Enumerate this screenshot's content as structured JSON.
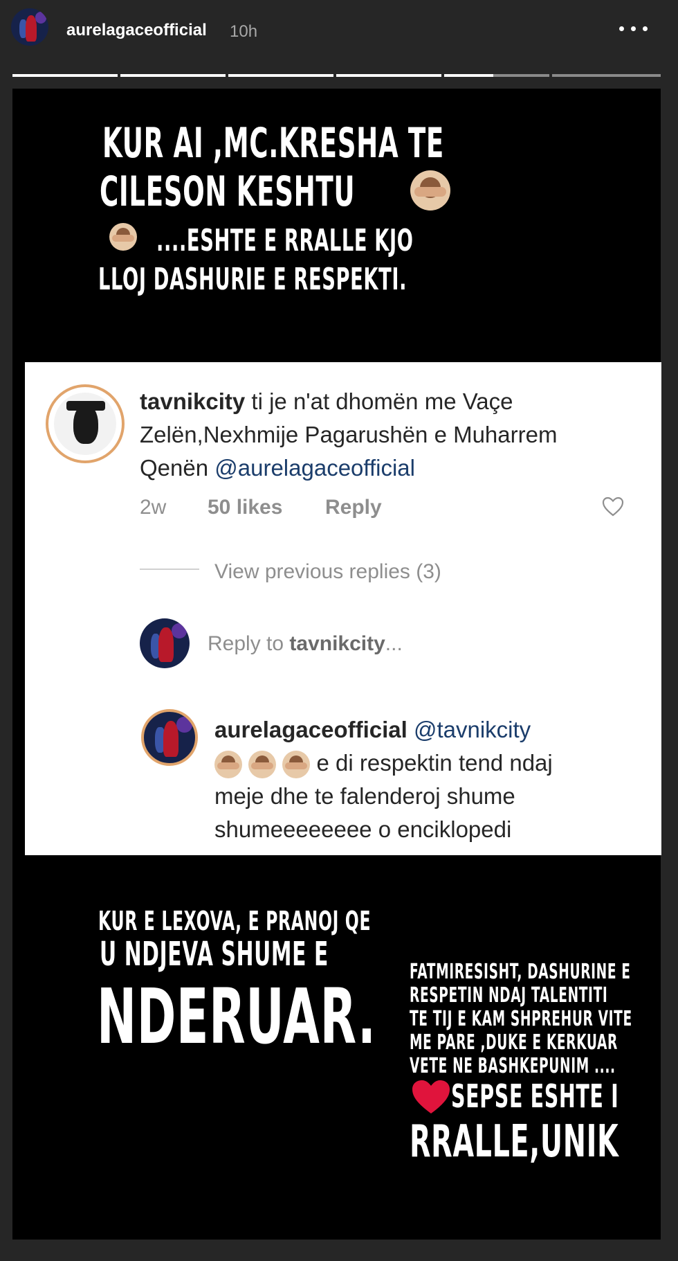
{
  "header": {
    "username": "aurelagaceofficial",
    "time": "10h",
    "more_icon": "more-horizontal-icon"
  },
  "progress": {
    "segments": 6,
    "current_index": 4,
    "current_fraction": 0.47
  },
  "story": {
    "top_text_lines": [
      "KUR AI ,MC.KRESHA TE",
      "CILESON KESHTU",
      "....ESHTE E RRALLE KJO",
      "LLOJ DASHURIE E RESPEKTI."
    ],
    "comment": {
      "username": "tavnikcity",
      "text_line1": " ti je n'at dhomën me Vaçe",
      "text_line2": "Zelën,Nexhmije Pagarushën e Muharrem",
      "text_line3": "Qenën ",
      "mention": "@aurelagaceofficial",
      "age": "2w",
      "likes": "50 likes",
      "reply": "Reply",
      "view_replies": "View previous replies (3)",
      "reply_to_prefix": "Reply to ",
      "reply_to_user": "tavnikcity",
      "reply_to_suffix": "...",
      "reply_username": "aurelagaceofficial",
      "reply_mention": " @tavnikcity",
      "reply_line1": " e di respektin tend ndaj",
      "reply_line2": "meje dhe te falenderoj shume",
      "reply_line3": "shumeeeeeeee o enciklopedi"
    },
    "left_text": {
      "line1": "KUR E LEXOVA, E PRANOJ QE",
      "line2": "U NDJEVA SHUME E",
      "line3": "NDERUAR."
    },
    "right_text": {
      "line1": "FATMIRESISHT,  DASHURINE E",
      "line2": "RESPETIN NDAJ  TALENTITI",
      "line3": "TE TIJ E KAM SHPREHUR VITE",
      "line4": "ME PARE ,DUKE E KERKUAR",
      "line5": "VETE NE BASHKEPUNIM ....",
      "line6": "SEPSE ESHTE I",
      "line7": "RRALLE,UNIK"
    }
  },
  "colors": {
    "accent_link": "#1b3d6b",
    "heart_red": "#e0143c"
  }
}
